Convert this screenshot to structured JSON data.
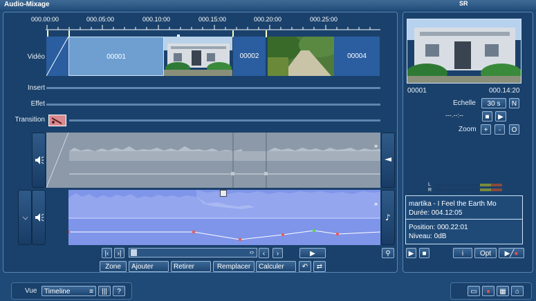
{
  "window": {
    "title": "Audio-Mixage",
    "logo": "SR"
  },
  "ruler": {
    "ticks": [
      "000.00:00",
      "000.05:00",
      "000.10:00",
      "000.15:00",
      "000.20:00",
      "000.25:00"
    ]
  },
  "tracks": {
    "video_label": "Vidéo",
    "insert_label": "Insert",
    "effet_label": "Effet",
    "transition_label": "Transition",
    "clips": [
      "00001",
      "00002",
      "00004"
    ]
  },
  "preview": {
    "start": "00001",
    "time": "000.14:20"
  },
  "scale": {
    "label": "Echelle",
    "value": "30 s",
    "n_button": "N",
    "time_placeholder": "---.--:--"
  },
  "zoom": {
    "label": "Zoom",
    "plus": "+",
    "minus": "-",
    "reset": "O"
  },
  "meter": {
    "left": "L",
    "right": "R"
  },
  "info": {
    "title": "martika - I Feel the Earth Mo",
    "duration": "Durée: 004.12:05",
    "position": "Position: 000.22:01",
    "level": "Niveau: 0dB"
  },
  "bottom_buttons": {
    "zone": "Zone",
    "ajouter": "Ajouter",
    "retirer": "Retirer",
    "remplacer": "Remplacer",
    "calculer": "Calculer"
  },
  "right_controls": {
    "info": "i",
    "opt": "Opt"
  },
  "footer": {
    "vue_label": "Vue",
    "vue_value": "Timeline"
  },
  "colors": {
    "bg": "#1f4a78",
    "audio_blue": "#7f95ea",
    "selected_clip": "#6f9fd0"
  }
}
